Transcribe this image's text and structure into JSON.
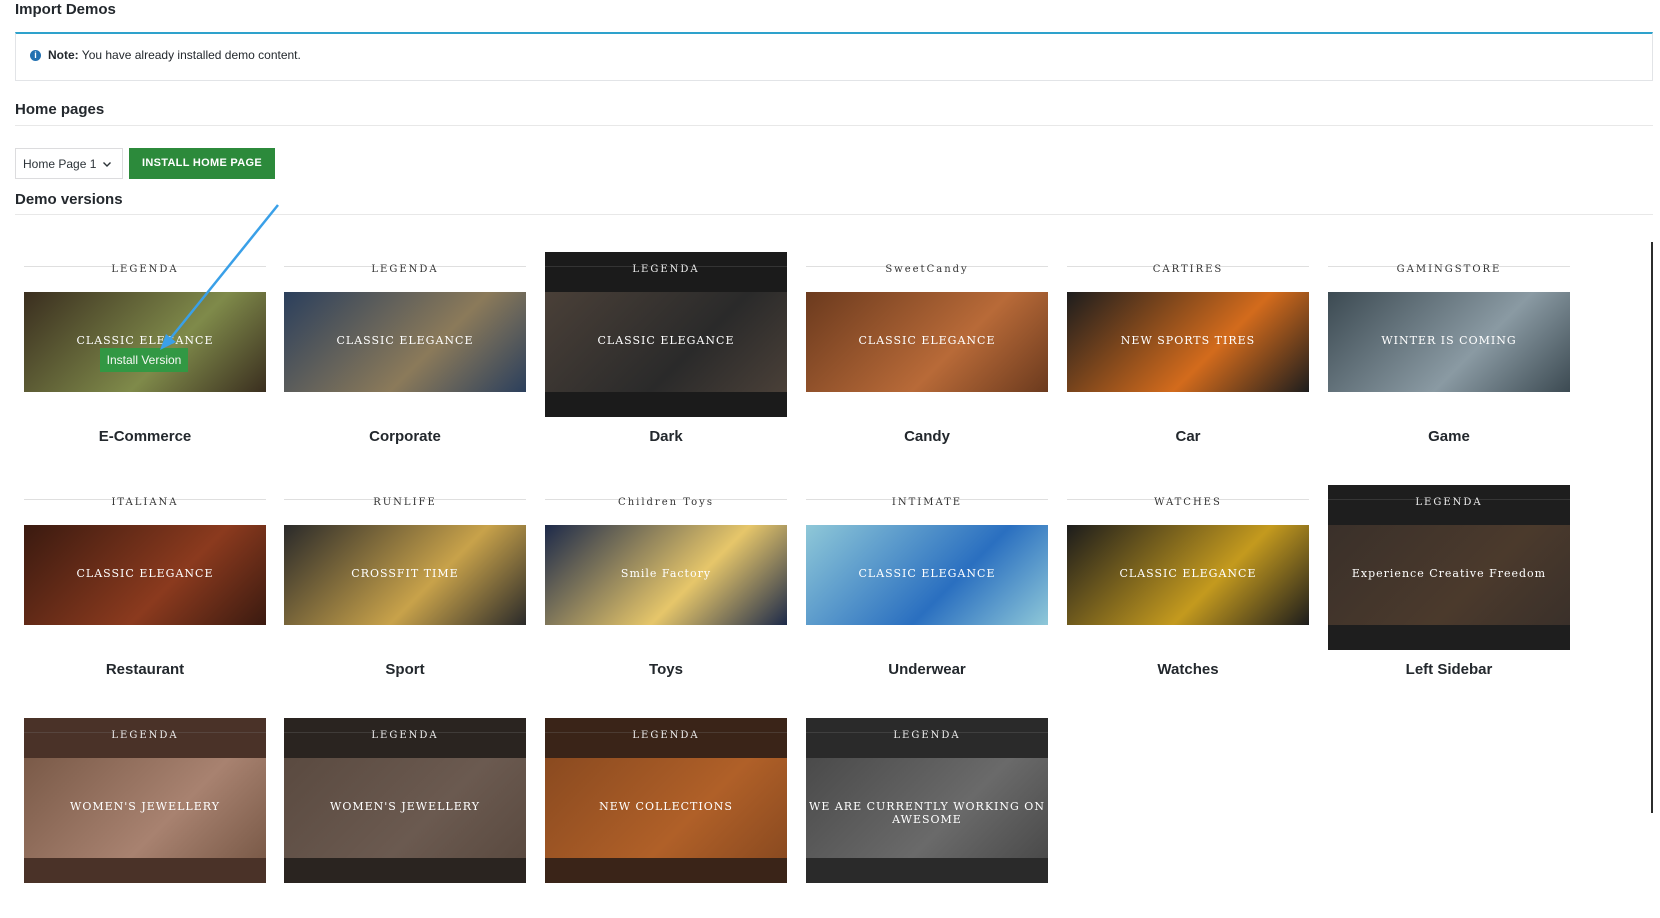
{
  "page_title": "Import Demos",
  "notice": {
    "icon": "info-icon",
    "bold": "Note:",
    "text": "You have already installed demo content."
  },
  "home_pages": {
    "title": "Home pages",
    "select_value": "Home Page 1",
    "install_button": "INSTALL HOME PAGE"
  },
  "demo_versions": {
    "title": "Demo versions",
    "hover_label": "Install Version",
    "items": [
      {
        "name": "E-Commerce",
        "logo": "LEGENDA",
        "hero": "CLASSIC ELEGANCE",
        "theme": [
          "#ffffff",
          "#3a2e1f",
          "#7f8a4a"
        ]
      },
      {
        "name": "Corporate",
        "logo": "LEGENDA",
        "hero": "CLASSIC ELEGANCE",
        "theme": [
          "#ffffff",
          "#2b3f5c",
          "#8b7a5a"
        ]
      },
      {
        "name": "Dark",
        "logo": "LEGENDA",
        "hero": "CLASSIC ELEGANCE",
        "theme": [
          "#1b1b1b",
          "#4a4038",
          "#2a2a2a"
        ]
      },
      {
        "name": "Candy",
        "logo": "SweetCandy",
        "hero": "CLASSIC ELEGANCE",
        "theme": [
          "#ffffff",
          "#6b3a1e",
          "#b86a38"
        ]
      },
      {
        "name": "Car",
        "logo": "CARTIRES",
        "hero": "NEW SPORTS TIRES",
        "theme": [
          "#ffffff",
          "#1d1d1d",
          "#d36b1c"
        ]
      },
      {
        "name": "Game",
        "logo": "GAMINGSTORE",
        "hero": "WINTER IS COMING",
        "theme": [
          "#ffffff",
          "#3c4a52",
          "#8a9aa3"
        ]
      },
      {
        "name": "Restaurant",
        "logo": "ITALIANA",
        "hero": "CLASSIC ELEGANCE",
        "theme": [
          "#ffffff",
          "#3a1a10",
          "#8b3a1e"
        ]
      },
      {
        "name": "Sport",
        "logo": "RUNLIFE",
        "hero": "CROSSFIT TIME",
        "theme": [
          "#ffffff",
          "#2a2a2a",
          "#c8a24a"
        ]
      },
      {
        "name": "Toys",
        "logo": "Children Toys",
        "hero": "Smile Factory",
        "theme": [
          "#ffffff",
          "#1d2a4a",
          "#e6c66a"
        ]
      },
      {
        "name": "Underwear",
        "logo": "INTIMATE",
        "hero": "CLASSIC ELEGANCE",
        "theme": [
          "#ffffff",
          "#8fc8d8",
          "#2a6fc0"
        ]
      },
      {
        "name": "Watches",
        "logo": "WATCHES",
        "hero": "CLASSIC ELEGANCE",
        "theme": [
          "#ffffff",
          "#1c1c1c",
          "#c49a1e"
        ]
      },
      {
        "name": "Left Sidebar",
        "logo": "LEGENDA",
        "hero": "Experience Creative Freedom",
        "theme": [
          "#1e1e1e",
          "#3a302a",
          "#4b3a2c"
        ]
      },
      {
        "name": "",
        "logo": "LEGENDA",
        "hero": "WOMEN'S JEWELLERY",
        "theme": [
          "#4a3228",
          "#7a5a48",
          "#a88270"
        ]
      },
      {
        "name": "",
        "logo": "LEGENDA",
        "hero": "WOMEN'S JEWELLERY",
        "theme": [
          "#2a2420",
          "#5a4a40",
          "#6b5a50"
        ]
      },
      {
        "name": "",
        "logo": "LEGENDA",
        "hero": "NEW COLLECTIONS",
        "theme": [
          "#3a2418",
          "#8a4a20",
          "#b06028"
        ]
      },
      {
        "name": "",
        "logo": "LEGENDA",
        "hero": "WE ARE CURRENTLY WORKING ON AWESOME",
        "theme": [
          "#2a2a2a",
          "#4a4a4a",
          "#6a6a6a"
        ]
      }
    ]
  },
  "colors": {
    "accent": "#2ea2cc",
    "install_green": "#2c8a3b",
    "arrow": "#3aa0e8"
  }
}
